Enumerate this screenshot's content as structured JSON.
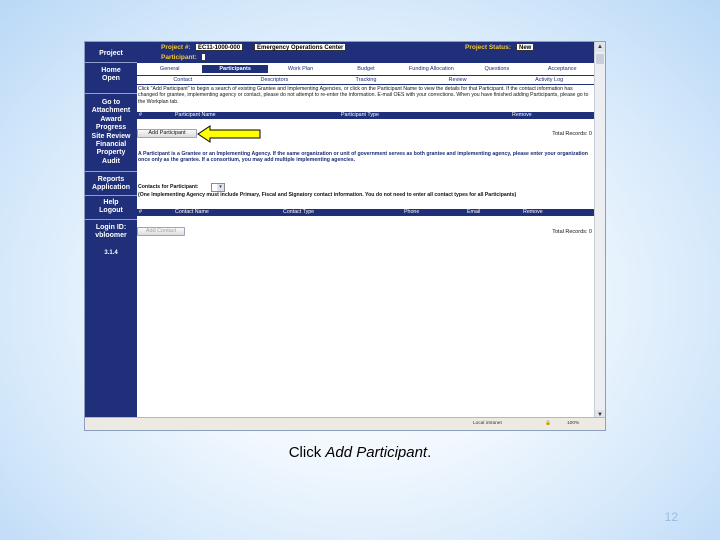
{
  "left_nav": {
    "project": "Project",
    "items": [
      {
        "label": "Home\nOpen"
      },
      {
        "label": "Go to\nAttachment\nAward\nProgress\nSite Review\nFinancial\nProperty\nAudit"
      },
      {
        "label": "Reports\nApplication"
      },
      {
        "label": "Help\nLogout"
      },
      {
        "label": "Login ID:\nvbloomer"
      }
    ],
    "version": "3.1.4"
  },
  "topbar": {
    "project_num_label": "Project #:",
    "project_num": "EC11-1000-000",
    "project_name": "Emergency Operations Center",
    "participant_label": "Participant:",
    "status_label": "Project Status:",
    "status": "New"
  },
  "tabs_row1": [
    "General",
    "Participants",
    "Work Plan",
    "Budget",
    "Funding Allocation",
    "Questions",
    "Acceptance"
  ],
  "tabs_row2": [
    "Contact",
    "Descriptors",
    "Tracking",
    "Review",
    "Activity Log"
  ],
  "instructions1": "Click \"Add Participant\" to begin a search of existing Grantee and Implementing Agencies, or click on the Participant Name to view the details for that Participant. If the contact information has changed for grantee, implementing agency or contact, please do not attempt to re-enter the information. E-mail OES with your corrections. When you have finished adding Participants, please go to the Workplan tab.",
  "participants_table": {
    "headers": [
      "#",
      "Participant Name",
      "Participant Type",
      "Remove"
    ],
    "add_button": "Add Participant",
    "total_label": "Total Records: 0"
  },
  "note": "A Participant is a Grantee or an Implementing Agency. If the same organization or unit of government serves as both grantee and implementing agency, please enter your organization once only as the grantee. If a consortium, you may add multiple implementing agencies.",
  "contacts": {
    "label": "Contacts for Participant:",
    "note": "(One Implementing Agency must include Primary, Fiscal and Signatory contact information. You do not need to enter all contact types for all Participants)",
    "headers": [
      "#",
      "Contact Name",
      "Contact Type",
      "Phone",
      "Email",
      "Remove"
    ],
    "add_button": "Add Contact",
    "total_label": "Total Records: 0"
  },
  "statusbar": {
    "left": "Local intranet",
    "zoom": "100%"
  },
  "caption": {
    "prefix": "Click ",
    "emphasis": "Add Participant",
    "suffix": "."
  },
  "slide_number": "12",
  "colors": {
    "nav_blue": "#1f2f7a",
    "label_gold": "#f4c838",
    "arrow_yellow": "#ffff00",
    "page_number": "#9bbce0"
  }
}
